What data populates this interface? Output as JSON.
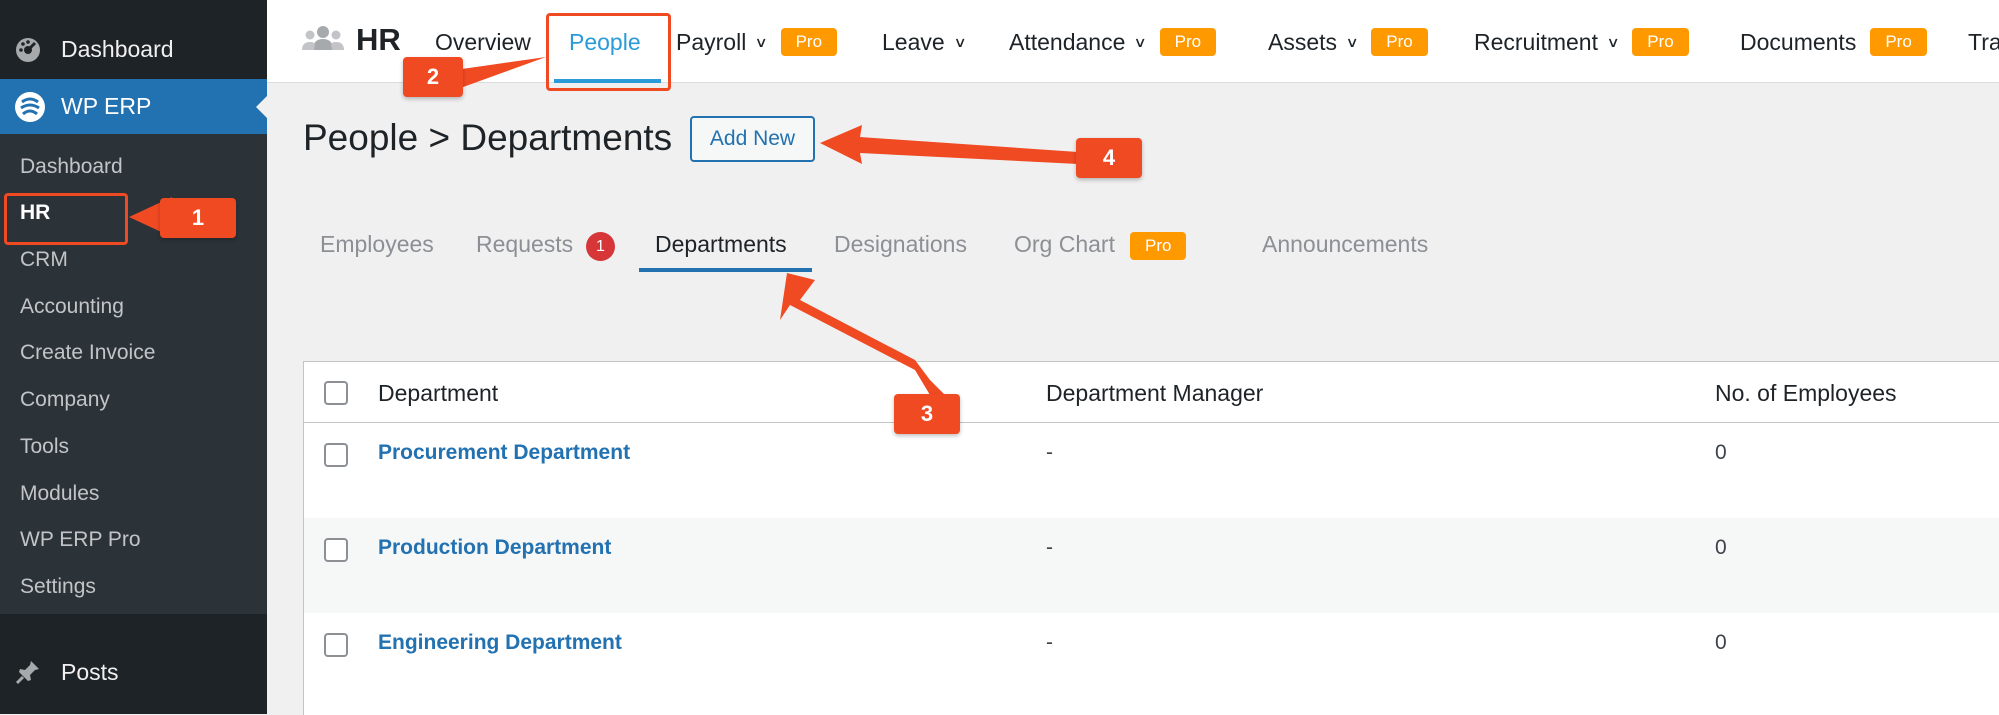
{
  "sidebar": {
    "dashboard": "Dashboard",
    "active_plugin": "WP ERP",
    "submenu": [
      "Dashboard",
      "HR",
      "CRM",
      "Accounting",
      "Create Invoice",
      "Company",
      "Tools",
      "Modules",
      "WP ERP Pro",
      "Settings"
    ],
    "posts": "Posts"
  },
  "topbar": {
    "brand": "HR",
    "nav": {
      "overview": "Overview",
      "people": "People",
      "payroll": "Payroll",
      "leave": "Leave",
      "attendance": "Attendance",
      "assets": "Assets",
      "recruitment": "Recruitment",
      "documents": "Documents",
      "truncated": "Tra"
    },
    "pro_label": "Pro"
  },
  "page": {
    "title": "People > Departments",
    "add_new": "Add New"
  },
  "subtabs": {
    "employees": "Employees",
    "requests": "Requests",
    "requests_count": "1",
    "departments": "Departments",
    "designations": "Designations",
    "org_chart": "Org Chart",
    "announcements": "Announcements"
  },
  "table": {
    "headers": [
      "Department",
      "Department Manager",
      "No. of Employees"
    ],
    "rows": [
      {
        "name": "Procurement Department",
        "manager": "-",
        "count": "0"
      },
      {
        "name": "Production Department",
        "manager": "-",
        "count": "0"
      },
      {
        "name": "Engineering Department",
        "manager": "-",
        "count": "0"
      }
    ]
  },
  "annotations": {
    "step1": "1",
    "step2": "2",
    "step3": "3",
    "step4": "4",
    "color": "#f04a23"
  },
  "colors": {
    "sidebar_bg": "#1d2327",
    "accent": "#2271b1",
    "pro_badge": "#ff9900",
    "link": "#2271b1"
  }
}
